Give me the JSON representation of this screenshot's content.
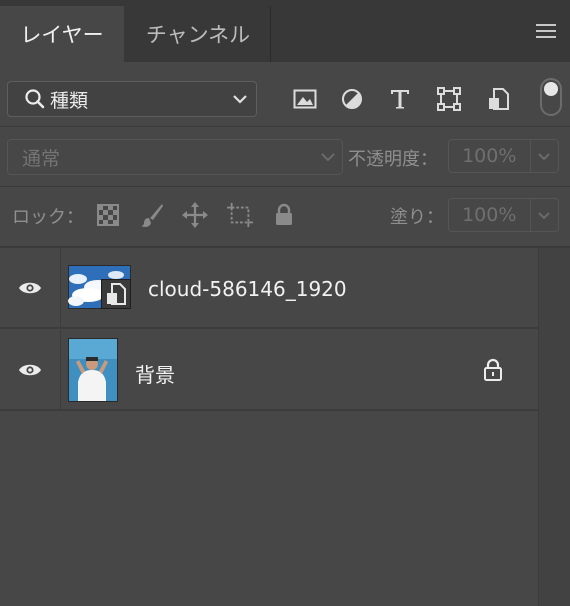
{
  "tabs": [
    {
      "label": "レイヤー",
      "active": true
    },
    {
      "label": "チャンネル",
      "active": false
    }
  ],
  "panel_menu_icon": "hamburger-icon",
  "filter": {
    "kind_label": "種類",
    "icons": [
      "image-filter-icon",
      "adjustment-filter-icon",
      "type-filter-icon",
      "shape-filter-icon",
      "smart-object-filter-icon"
    ],
    "toggle_on": true
  },
  "blend": {
    "mode": "通常",
    "opacity_label": "不透明度：",
    "opacity_value": "100%"
  },
  "lock": {
    "label": "ロック：",
    "icons": [
      "lock-transparent-pixels-icon",
      "lock-image-pixels-icon",
      "lock-position-icon",
      "lock-artboard-icon",
      "lock-all-icon"
    ],
    "fill_label": "塗り：",
    "fill_value": "100%"
  },
  "layers": [
    {
      "name": "cloud-586146_1920",
      "visible": true,
      "smart_object": true,
      "locked": false
    },
    {
      "name": "背景",
      "visible": true,
      "smart_object": false,
      "locked": true
    }
  ],
  "colors": {
    "panel_bg": "#474747",
    "tabbar_bg": "#383838",
    "divider": "#3a3a3a"
  }
}
